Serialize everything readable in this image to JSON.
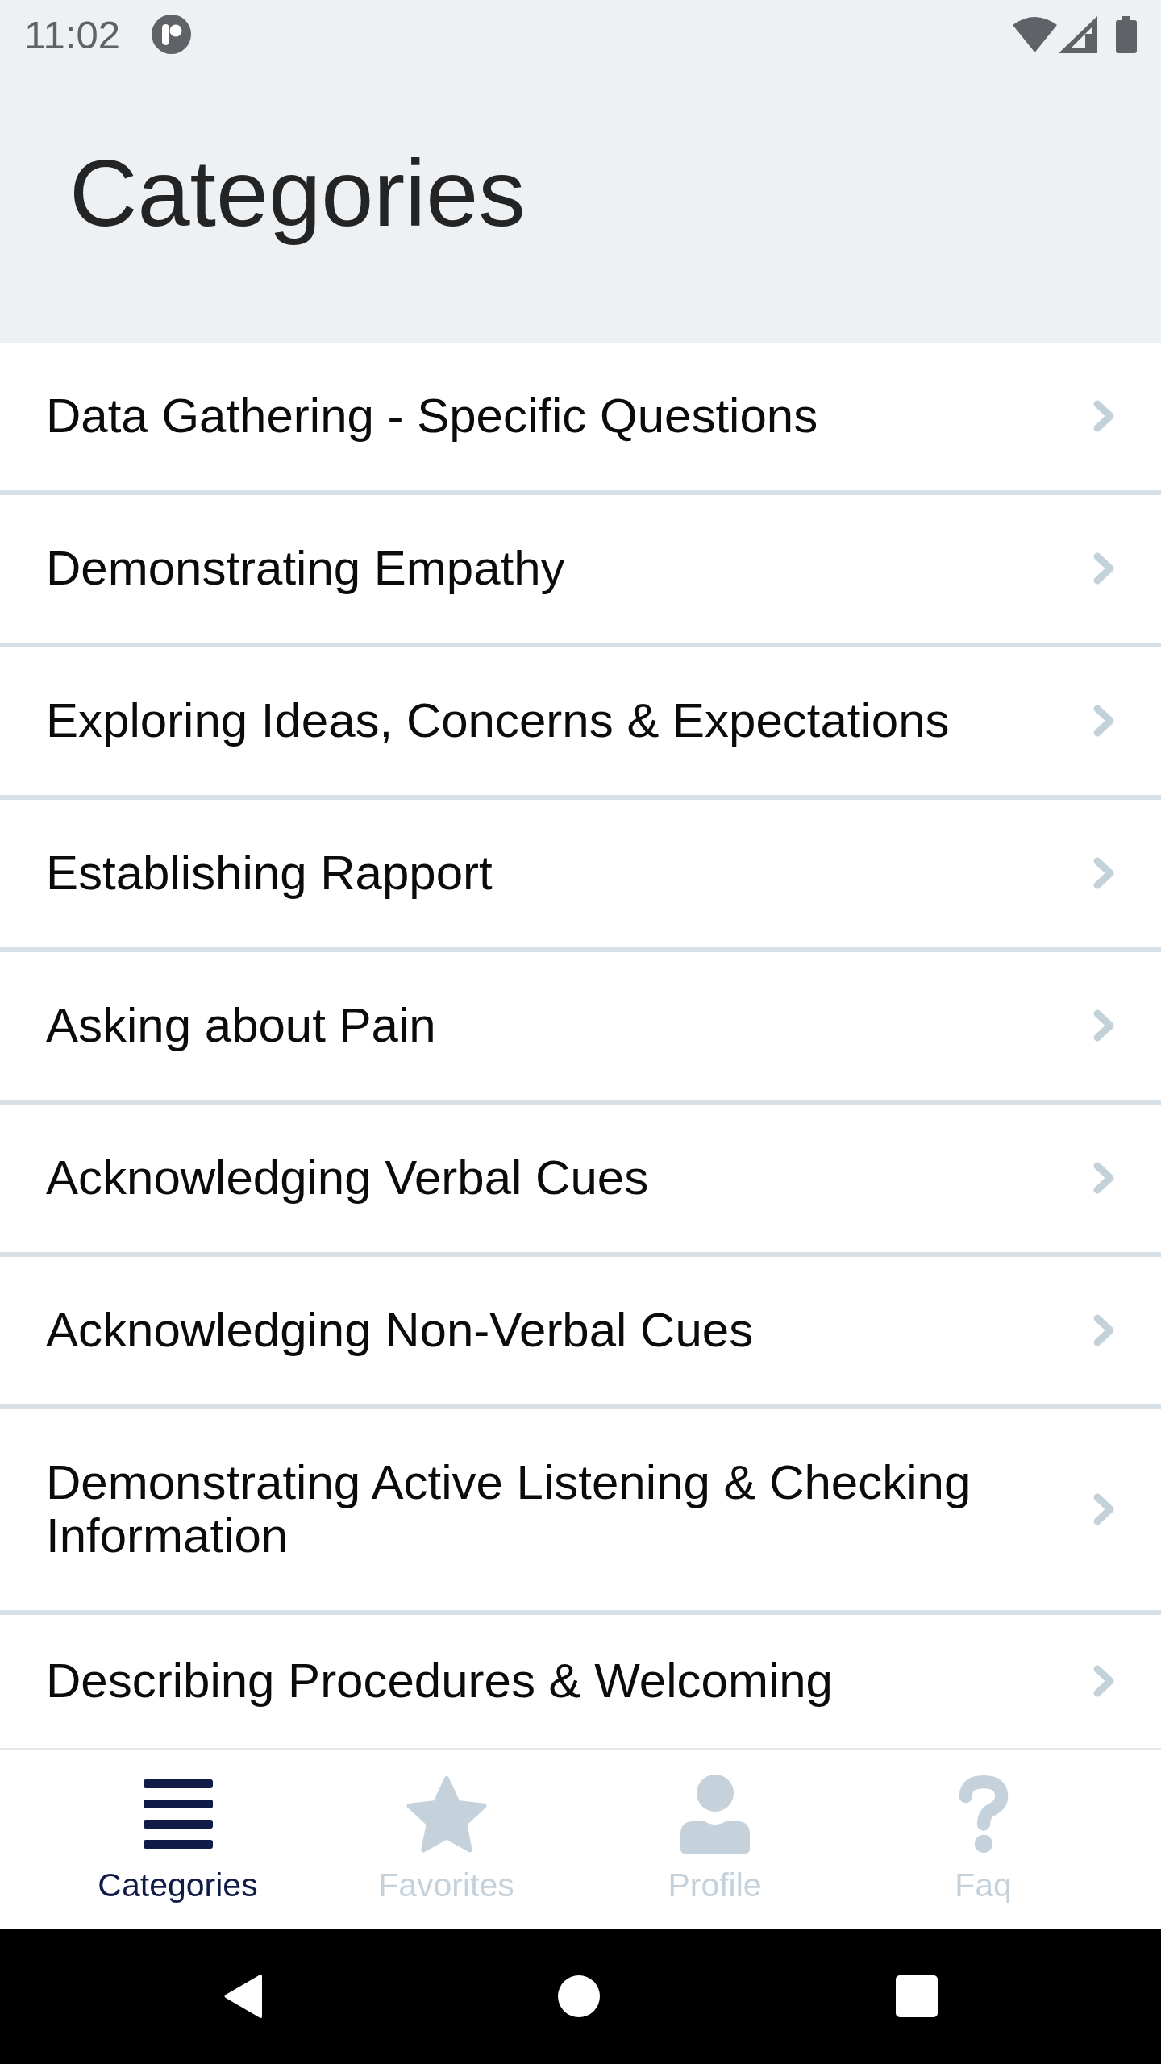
{
  "status_bar": {
    "time": "11:02"
  },
  "header": {
    "title": "Categories"
  },
  "categories": [
    {
      "label": "Data Gathering - Specific Questions"
    },
    {
      "label": "Demonstrating Empathy"
    },
    {
      "label": "Exploring Ideas, Concerns & Expectations"
    },
    {
      "label": "Establishing Rapport"
    },
    {
      "label": "Asking about Pain"
    },
    {
      "label": "Acknowledging Verbal Cues"
    },
    {
      "label": "Acknowledging Non-Verbal Cues"
    },
    {
      "label": "Demonstrating Active Listening & Checking Information"
    },
    {
      "label": "Describing Procedures & Welcoming"
    }
  ],
  "bottom_nav": [
    {
      "label": "Categories",
      "kind": "menu",
      "selected": true
    },
    {
      "label": "Favorites",
      "kind": "star",
      "selected": false
    },
    {
      "label": "Profile",
      "kind": "person",
      "selected": false
    },
    {
      "label": "Faq",
      "kind": "question",
      "selected": false
    }
  ]
}
